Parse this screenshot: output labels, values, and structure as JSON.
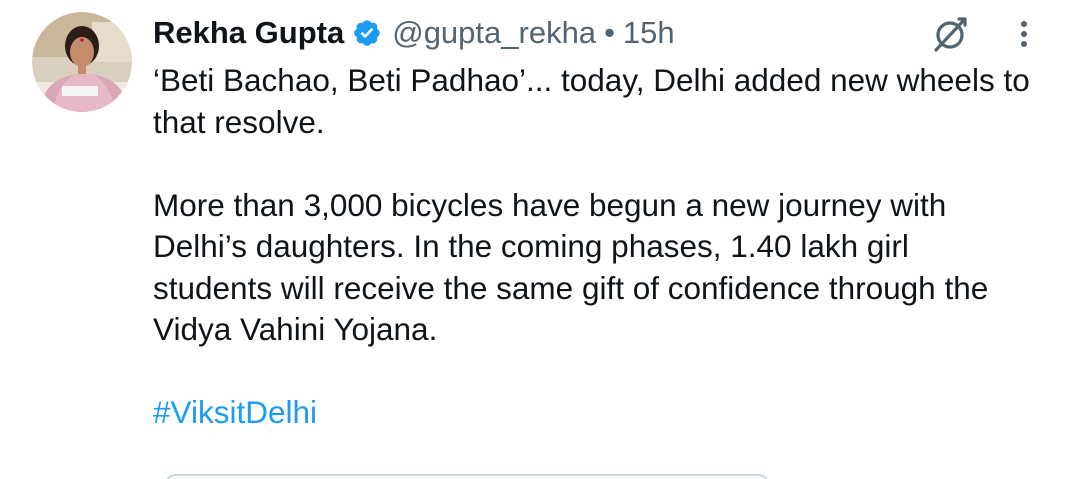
{
  "author": {
    "display_name": "Rekha Gupta",
    "handle": "@gupta_rekha",
    "separator": "•",
    "timestamp": "15h",
    "verified": true,
    "verified_color": "#1d9bf0"
  },
  "tweet": {
    "paragraph_1": "‘Beti Bachao, Beti Padhao’... today, Delhi added new wheels to that resolve.",
    "paragraph_2": "More than 3,000 bicycles have begun a new journey with Delhi’s daughters. In the coming phases, 1.40 lakh girl students will receive the same gift of confidence through the Vidya Vahini Yojana.",
    "hashtag": "#ViksitDelhi"
  },
  "icons": {
    "avatar": "profile-photo",
    "verified": "verified-badge-icon",
    "grok": "grok-icon",
    "more": "more-vertical-icon"
  },
  "colors": {
    "text": "#0f1419",
    "secondary": "#536471",
    "link": "#1d9bf0"
  }
}
